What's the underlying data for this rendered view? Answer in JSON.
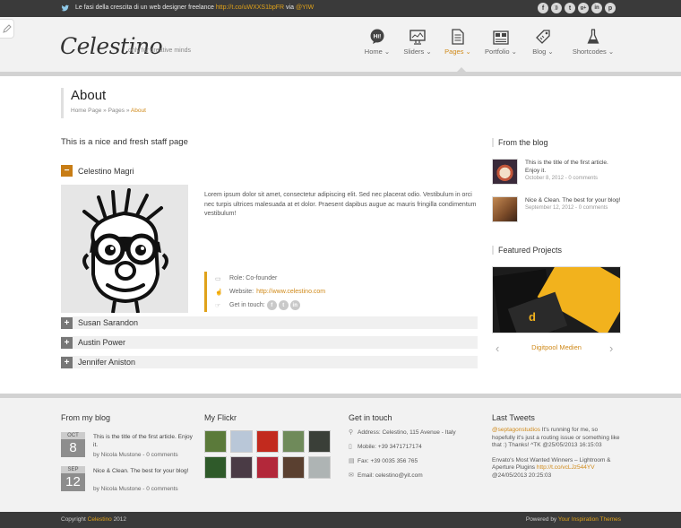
{
  "topbar": {
    "tweet_text": "Le fasi della crescita di un web designer freelance",
    "tweet_link": "http://t.co/uWXXS1bpFR",
    "tweet_via": "via",
    "tweet_user": "@YIW",
    "social": [
      "f",
      "rss",
      "t",
      "g+",
      "in",
      "p"
    ]
  },
  "header": {
    "logo": "Celestino",
    "tagline": "only for creative minds"
  },
  "nav": [
    {
      "label": "Home",
      "icon": "hi-bubble-icon"
    },
    {
      "label": "Sliders",
      "icon": "monitor-icon"
    },
    {
      "label": "Pages",
      "icon": "page-icon"
    },
    {
      "label": "Portfolio",
      "icon": "grid-icon"
    },
    {
      "label": "Blog",
      "icon": "tag-icon"
    },
    {
      "label": "Shortcodes",
      "icon": "flask-icon"
    }
  ],
  "page": {
    "title": "About",
    "breadcrumb": [
      "Home Page",
      "Pages",
      "About"
    ],
    "breadcrumb_sep": "»",
    "intro": "This is a nice and fresh staff page"
  },
  "accordion": {
    "open": {
      "name": "Celestino Magri",
      "bio": "Lorem ipsum dolor sit amet, consectetur adipiscing elit. Sed nec placerat odio. Vestibulum in orci nec turpis ultrices malesuada at et dolor. Praesent dapibus augue ac mauris fringilla condimentum vestibulum!",
      "role_label": "Role:",
      "role": "Co-founder",
      "website_label": "Website:",
      "website": "http://www.celestino.com",
      "touch_label": "Get in touch:",
      "toggle": "−"
    },
    "closed": [
      {
        "name": "Susan Sarandon",
        "toggle": "+"
      },
      {
        "name": "Austin Power",
        "toggle": "+"
      },
      {
        "name": "Jennifer Aniston",
        "toggle": "+"
      }
    ]
  },
  "sidebar": {
    "blog_title": "From the blog",
    "posts": [
      {
        "title": "This is the title of the first article. Enjoy it.",
        "meta": "October 8, 2012 - 0 comments"
      },
      {
        "title": "Nice & Clean. The best for your blog!",
        "meta": "September 12, 2012 - 0 comments"
      }
    ],
    "featured_title": "Featured Projects",
    "featured_caption": "Digitpool Medien",
    "prev": "‹",
    "next": "›"
  },
  "footer": {
    "blog_title": "From my blog",
    "posts": [
      {
        "month": "OCT",
        "day": "8",
        "title": "This is the title of the first article. Enjoy it.",
        "meta": "by Nicola Mustone - 0 comments"
      },
      {
        "month": "SEP",
        "day": "12",
        "title": "Nice & Clean. The best for your blog!",
        "meta": "by Nicola Mustone - 0 comments"
      }
    ],
    "flickr_title": "My Flickr",
    "flickr_colors": [
      "#5b7a3a",
      "#b9c7d8",
      "#c22a1e",
      "#6f8a5a",
      "#3a3f38",
      "#2f5a2a",
      "#4a3b45",
      "#b3283a",
      "#5a4030",
      "#aeb4b4"
    ],
    "contact_title": "Get in touch",
    "contact": [
      {
        "label": "Address:",
        "value": "Celestino, 115 Avenue - Italy"
      },
      {
        "label": "Mobile:",
        "value": "+39 3471717174"
      },
      {
        "label": "Fax:",
        "value": "+39 0035 356 765"
      },
      {
        "label": "Email:",
        "value": "celestino@yit.com"
      }
    ],
    "tweets_title": "Last Tweets",
    "tweet1_user": "@septagonstudios",
    "tweet1_text": "It's running for me, so hopefully it's just a routing issue or something like that :) Thanks! ^TK",
    "tweet1_date": "@25/05/2013 16:15:03",
    "tweet2_text": "Envato's Most Wanted Winners – Lightroom & Aperture Plugins",
    "tweet2_link": "http://t.co/vcLJz544YV",
    "tweet2_date": "@24/05/2013 20:25:03"
  },
  "bottombar": {
    "copyright": "Copyright",
    "brand": "Celestino",
    "year": "2012",
    "powered": "Powered by",
    "powered_brand": "Your Inspiration Themes"
  }
}
